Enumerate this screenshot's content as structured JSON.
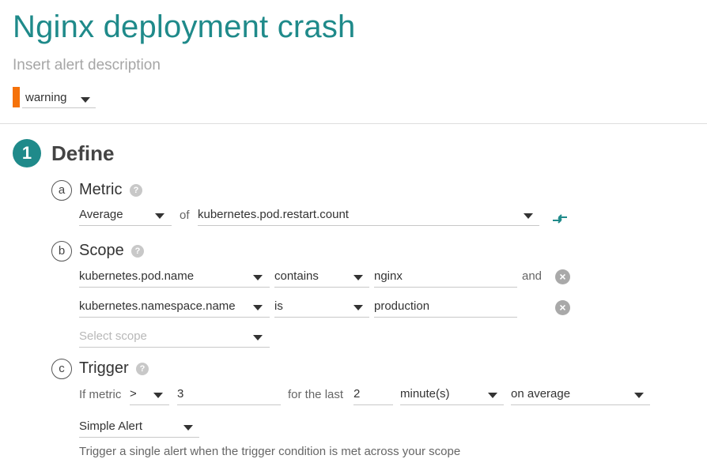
{
  "alert": {
    "title": "Nginx deployment crash",
    "description_placeholder": "Insert alert description",
    "severity": "warning",
    "severity_color": "#f5720a"
  },
  "define": {
    "step_number": "1",
    "title": "Define",
    "metric": {
      "letter": "a",
      "title": "Metric",
      "help": "?",
      "aggregation": "Average",
      "of_label": "of",
      "name": "kubernetes.pod.restart.count"
    },
    "scope": {
      "letter": "b",
      "title": "Scope",
      "help": "?",
      "rows": [
        {
          "key": "kubernetes.pod.name",
          "operator": "contains",
          "value": "nginx",
          "conj": "and"
        },
        {
          "key": "kubernetes.namespace.name",
          "operator": "is",
          "value": "production",
          "conj": ""
        }
      ],
      "select_placeholder": "Select scope"
    },
    "trigger": {
      "letter": "c",
      "title": "Trigger",
      "help": "?",
      "if_metric_label": "If metric",
      "comparator": ">",
      "threshold": "3",
      "for_last_label": "for the last",
      "duration": "2",
      "unit": "minute(s)",
      "aggregation": "on average",
      "alert_type": "Simple Alert",
      "hint": "Trigger a single alert when the trigger condition is met across your scope"
    }
  },
  "icons": {
    "remove": "×",
    "accent": "#1f8a8a"
  }
}
